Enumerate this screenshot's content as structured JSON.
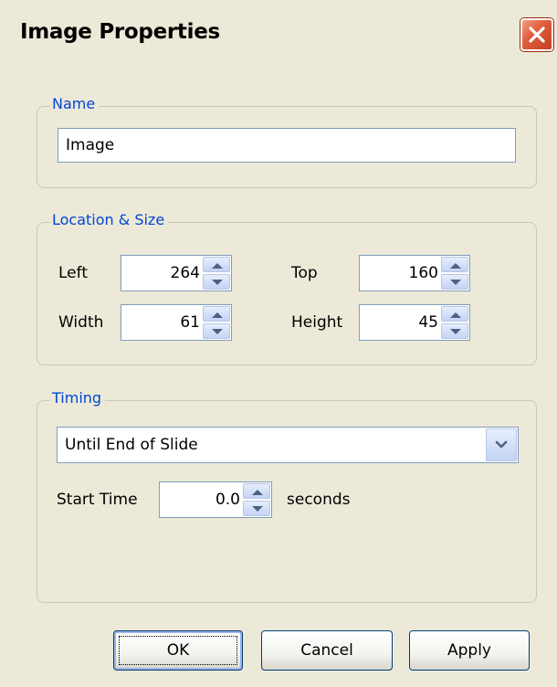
{
  "dialog": {
    "title": "Image Properties"
  },
  "name_group": {
    "legend": "Name",
    "name_value": "Image"
  },
  "location_group": {
    "legend": "Location & Size",
    "left_label": "Left",
    "left_value": "264",
    "top_label": "Top",
    "top_value": "160",
    "width_label": "Width",
    "width_value": "61",
    "height_label": "Height",
    "height_value": "45"
  },
  "timing_group": {
    "legend": "Timing",
    "duration_selected": "Until End of Slide",
    "start_time_label": "Start Time",
    "start_time_value": "0.0",
    "seconds_label": "seconds"
  },
  "buttons": {
    "ok": "OK",
    "cancel": "Cancel",
    "apply": "Apply"
  },
  "icons": {
    "close": "close-icon",
    "spin_up": "arrow-up-icon",
    "spin_down": "arrow-down-icon",
    "dropdown": "chevron-down-icon"
  },
  "colors": {
    "legend_text": "#0046d5",
    "background": "#ece9d8",
    "close_button": "#e0603e"
  }
}
